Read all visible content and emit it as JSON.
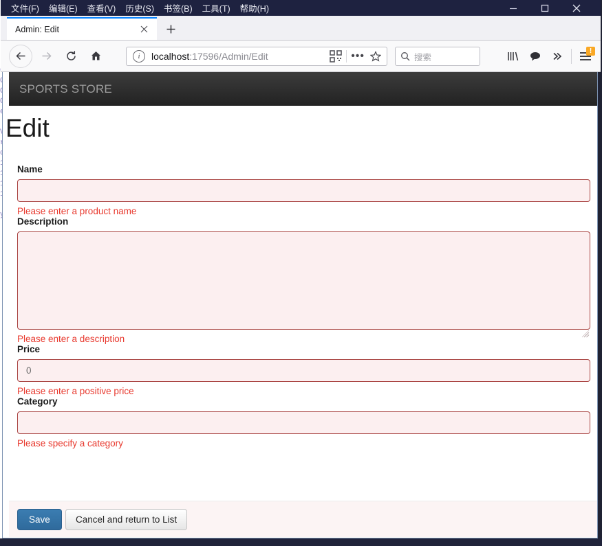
{
  "window": {
    "menus": [
      {
        "label": "文件(F)",
        "accel": "F"
      },
      {
        "label": "编辑(E)",
        "accel": "E"
      },
      {
        "label": "查看(V)",
        "accel": "V"
      },
      {
        "label": "历史(S)",
        "accel": "S"
      },
      {
        "label": "书签(B)",
        "accel": "B"
      },
      {
        "label": "工具(T)",
        "accel": "T"
      },
      {
        "label": "帮助(H)",
        "accel": "H"
      }
    ],
    "controls": {
      "minimize": "—",
      "maximize": "☐",
      "close": "✕"
    },
    "titlebar_color": "#1e2240"
  },
  "tabs": {
    "active": {
      "title": "Admin: Edit",
      "close_label": "✕"
    },
    "new_tab_label": "+"
  },
  "toolbar": {
    "back": "←",
    "forward": "→",
    "reload": "↻",
    "home": "⌂",
    "url": {
      "host": "localhost",
      "path": ":17596/Admin/Edit",
      "full": "localhost:17596/Admin/Edit"
    },
    "search": {
      "placeholder": "搜索"
    },
    "library_icon": "library-icon",
    "sync_icon": "chat-icon",
    "overflow": "»",
    "menu_badge": "!"
  },
  "page": {
    "brand": "SPORTS STORE",
    "title": "Edit",
    "fields": [
      {
        "label": "Name",
        "type": "input",
        "value": "",
        "error": "Please enter a product name"
      },
      {
        "label": "Description",
        "type": "textarea",
        "value": "",
        "error": "Please enter a description"
      },
      {
        "label": "Price",
        "type": "input",
        "value": "0",
        "error": "Please enter a positive price"
      },
      {
        "label": "Category",
        "type": "input",
        "value": "",
        "error": "Please specify a category"
      }
    ],
    "buttons": {
      "save": "Save",
      "cancel": "Cancel and return to List"
    }
  },
  "colors": {
    "accent_primary": "#337ab7",
    "error_text": "#e8382d",
    "error_border": "#a94442",
    "error_bg": "#fceff0",
    "banner_dark": "#222222",
    "banner_light": "#3c3c3c",
    "badge_orange": "#f9a825"
  },
  "background_code": [
    "C",
    "C",
    "C",
    "C",
    "e",
    "",
    "V",
    "r",
    "c",
    "1",
    "1",
    "1",
    "1",
    "",
    "y"
  ]
}
